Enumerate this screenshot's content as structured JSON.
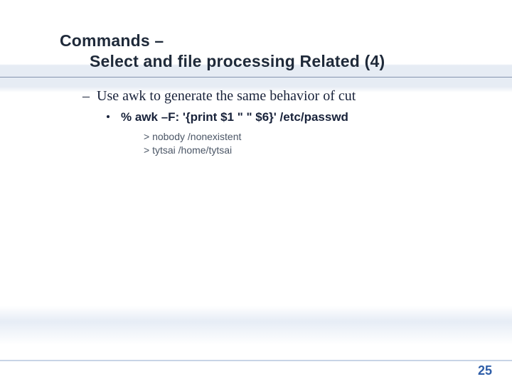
{
  "title": {
    "line1": "Commands –",
    "line2": "Select and file processing Related (4)"
  },
  "body": {
    "point": "Use awk to generate the same behavior of cut",
    "command": "% awk –F: '{print $1 \"  \" $6}' /etc/passwd",
    "output": [
      "nobody /nonexistent",
      "tytsai /home/tytsai"
    ]
  },
  "page_number": "25"
}
